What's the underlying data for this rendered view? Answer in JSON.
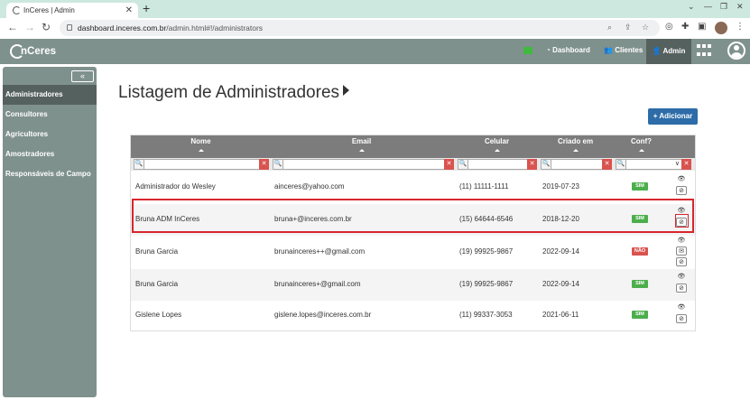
{
  "browser": {
    "tab_title": "InCeres | Admin",
    "tab_close": "✕",
    "new_tab": "+",
    "url_host": "dashboard.inceres.com.br",
    "url_path": "/admin.html#!/administrators"
  },
  "header": {
    "logo": "nCeres",
    "nav": [
      {
        "label": "Dashboard",
        "icon": "tachometer-icon"
      },
      {
        "label": "Clientes",
        "icon": "users-icon"
      },
      {
        "label": "Admin",
        "icon": "user-shield-icon"
      }
    ]
  },
  "sidebar": {
    "collapse_label": "«",
    "items": [
      {
        "label": "Administradores",
        "active": true
      },
      {
        "label": "Consultores"
      },
      {
        "label": "Agricultores"
      },
      {
        "label": "Amostradores"
      },
      {
        "label": "Responsáveis de Campo"
      }
    ]
  },
  "main": {
    "title": "Listagem de Administradores",
    "add_button": "+ Adicionar",
    "columns": [
      "Nome",
      "Email",
      "Celular",
      "Criado em",
      "Conf?"
    ],
    "filter_search_icon": "🔍",
    "filter_clear": "✕",
    "filter_dropdown": "∨",
    "rows": [
      {
        "name": "Administrador do Wesley",
        "email": "ainceres@yahoo.com",
        "phone": "(11) 11111-1111",
        "created": "2019-07-23",
        "conf": "SIM"
      },
      {
        "name": "Bruna ADM InCeres",
        "email": "bruna+@inceres.com.br",
        "phone": "(15) 64644-6546",
        "created": "2018-12-20",
        "conf": "SIM"
      },
      {
        "name": "Bruna Garcia",
        "email": "brunainceres++@gmail.com",
        "phone": "(19) 99925-9867",
        "created": "2022-09-14",
        "conf": "NÃO"
      },
      {
        "name": "Bruna Garcia",
        "email": "brunainceres+@gmail.com",
        "phone": "(19) 99925-9867",
        "created": "2022-09-14",
        "conf": "SIM"
      },
      {
        "name": "Gislene Lopes",
        "email": "gislene.lopes@inceres.com.br",
        "phone": "(11) 99337-3053",
        "created": "2021-06-11",
        "conf": "SIM"
      }
    ]
  },
  "colors": {
    "header": "#7f918d",
    "active": "#55615e",
    "add_button": "#2d6ca8",
    "highlight": "#d7262d",
    "badge_yes": "#4cae4c",
    "badge_no": "#d9534f"
  }
}
